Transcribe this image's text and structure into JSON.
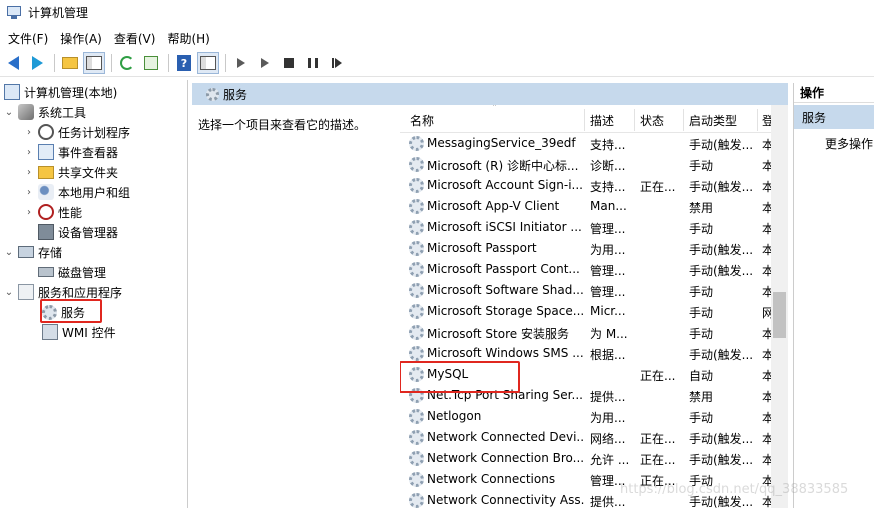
{
  "window": {
    "title": "计算机管理"
  },
  "menu": [
    "文件(F)",
    "操作(A)",
    "查看(V)",
    "帮助(H)"
  ],
  "toolbar": {
    "icons": [
      "back-icon",
      "forward-icon",
      "up-folder-icon",
      "show-hide-tree-icon",
      "refresh-icon",
      "export-list-icon",
      "help-icon",
      "show-hide-action-pane-icon",
      "start-service-icon",
      "start-service-alt-icon",
      "stop-service-icon",
      "pause-service-icon",
      "restart-service-icon"
    ]
  },
  "tree": {
    "root": "计算机管理(本地)",
    "system_tools": "系统工具",
    "task_scheduler": "任务计划程序",
    "event_viewer": "事件查看器",
    "shared_folders": "共享文件夹",
    "local_users": "本地用户和组",
    "performance": "性能",
    "device_manager": "设备管理器",
    "storage": "存储",
    "disk_management": "磁盘管理",
    "services_apps": "服务和应用程序",
    "services": "服务",
    "wmi": "WMI 控件"
  },
  "panel": {
    "title": "服务",
    "description": "选择一个项目来查看它的描述。"
  },
  "table": {
    "headers": {
      "name": "名称",
      "desc": "描述",
      "status": "状态",
      "startup": "启动类型",
      "login": "登"
    },
    "rows": [
      {
        "name": "MessagingService_39edf",
        "desc": "支持...",
        "status": "",
        "startup": "手动(触发...",
        "login": "本"
      },
      {
        "name": "Microsoft (R) 诊断中心标...",
        "desc": "诊断...",
        "status": "",
        "startup": "手动",
        "login": "本"
      },
      {
        "name": "Microsoft Account Sign-i...",
        "desc": "支持...",
        "status": "正在...",
        "startup": "手动(触发...",
        "login": "本"
      },
      {
        "name": "Microsoft App-V Client",
        "desc": "Man...",
        "status": "",
        "startup": "禁用",
        "login": "本"
      },
      {
        "name": "Microsoft iSCSI Initiator ...",
        "desc": "管理...",
        "status": "",
        "startup": "手动",
        "login": "本"
      },
      {
        "name": "Microsoft Passport",
        "desc": "为用...",
        "status": "",
        "startup": "手动(触发...",
        "login": "本"
      },
      {
        "name": "Microsoft Passport Cont...",
        "desc": "管理...",
        "status": "",
        "startup": "手动(触发...",
        "login": "本"
      },
      {
        "name": "Microsoft Software Shad...",
        "desc": "管理...",
        "status": "",
        "startup": "手动",
        "login": "本"
      },
      {
        "name": "Microsoft Storage Space...",
        "desc": "Micr...",
        "status": "",
        "startup": "手动",
        "login": "网"
      },
      {
        "name": "Microsoft Store 安装服务",
        "desc": "为 M...",
        "status": "",
        "startup": "手动",
        "login": "本"
      },
      {
        "name": "Microsoft Windows SMS ...",
        "desc": "根据...",
        "status": "",
        "startup": "手动(触发...",
        "login": "本"
      },
      {
        "name": "MySQL",
        "desc": "",
        "status": "正在...",
        "startup": "自动",
        "login": "本"
      },
      {
        "name": "Net.Tcp Port Sharing Ser...",
        "desc": "提供...",
        "status": "",
        "startup": "禁用",
        "login": "本"
      },
      {
        "name": "Netlogon",
        "desc": "为用...",
        "status": "",
        "startup": "手动",
        "login": "本"
      },
      {
        "name": "Network Connected Devi...",
        "desc": "网络...",
        "status": "正在...",
        "startup": "手动(触发...",
        "login": "本"
      },
      {
        "name": "Network Connection Bro...",
        "desc": "允许 ...",
        "status": "正在...",
        "startup": "手动(触发...",
        "login": "本"
      },
      {
        "name": "Network Connections",
        "desc": "管理...",
        "status": "正在...",
        "startup": "手动",
        "login": "本"
      },
      {
        "name": "Network Connectivity Ass...",
        "desc": "提供...",
        "status": "",
        "startup": "手动(触发...",
        "login": "本"
      }
    ]
  },
  "actions": {
    "header": "操作",
    "section": "服务",
    "more": "更多操作"
  },
  "watermark": "https://blog.csdn.net/qq_38833585"
}
